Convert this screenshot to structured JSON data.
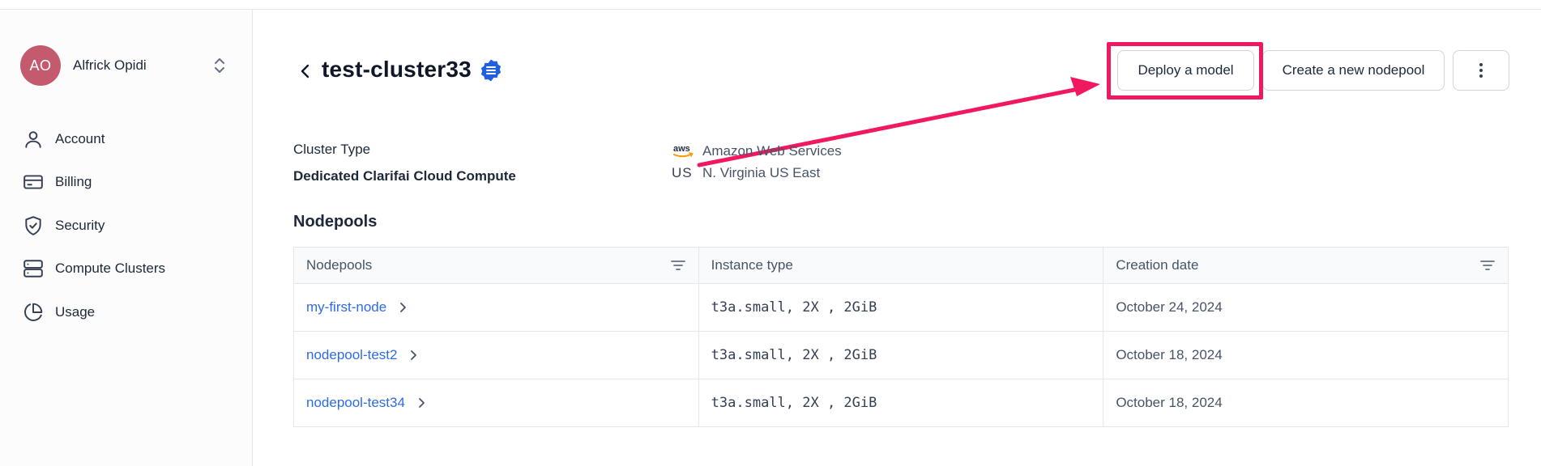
{
  "user": {
    "initials": "AO",
    "name": "Alfrick Opidi",
    "avatar_color": "#c45a6e"
  },
  "sidebar": {
    "items": [
      {
        "label": "Account",
        "icon": "user-icon"
      },
      {
        "label": "Billing",
        "icon": "credit-card-icon"
      },
      {
        "label": "Security",
        "icon": "shield-check-icon"
      },
      {
        "label": "Compute Clusters",
        "icon": "server-icon"
      },
      {
        "label": "Usage",
        "icon": "pie-chart-icon"
      }
    ]
  },
  "header": {
    "title": "test-cluster33",
    "buttons": {
      "deploy": "Deploy a model",
      "create": "Create a new nodepool",
      "more": "⋮"
    },
    "highlight_color": "#f0195f"
  },
  "cluster": {
    "type_label": "Cluster Type",
    "type_value": "Dedicated Clarifai Cloud Compute",
    "provider_logo": "aws",
    "provider": "Amazon Web Services",
    "region_code": "US",
    "region": "N. Virginia US East"
  },
  "nodepools": {
    "section_title": "Nodepools",
    "columns": [
      "Nodepools",
      "Instance type",
      "Creation date"
    ],
    "rows": [
      {
        "name": "my-first-node",
        "instance": "t3a.small, 2X , 2GiB",
        "date": "October 24, 2024"
      },
      {
        "name": "nodepool-test2",
        "instance": "t3a.small, 2X , 2GiB",
        "date": "October 18, 2024"
      },
      {
        "name": "nodepool-test34",
        "instance": "t3a.small, 2X , 2GiB",
        "date": "October 18, 2024"
      }
    ]
  },
  "colors": {
    "link": "#2e6be6",
    "accent": "#1f5fe0"
  }
}
